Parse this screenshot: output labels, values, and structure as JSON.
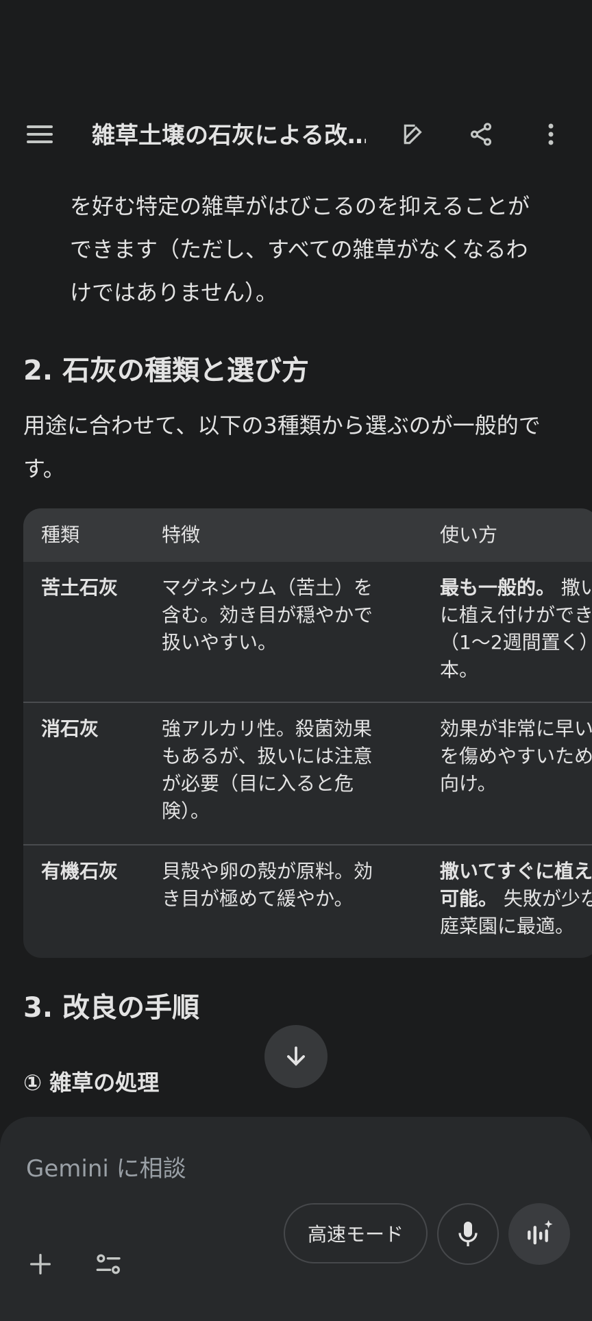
{
  "header": {
    "title": "雑草土壌の石灰による改…",
    "icons": [
      "menu-icon",
      "edit-icon",
      "share-icon",
      "more-vert-icon"
    ]
  },
  "intro_para": {
    "lines": [
      "を好む特定の雑草がはびこるのを抑えることが",
      "できます（ただし、すべての雑草がなくなるわ",
      "けではありません）。"
    ]
  },
  "section2": {
    "heading": "2. 石灰の種類と選び方",
    "para_lines": [
      "用途に合わせて、以下の3種類から選ぶのが一般的で",
      "す。"
    ]
  },
  "table": {
    "headers": [
      "種類",
      "特徴",
      "使い方"
    ],
    "rows": [
      {
        "type": "苦土石灰",
        "feature": [
          "マグネシウム（苦土）を",
          "含む。効き目が穏やかで",
          "扱いやすい。"
        ],
        "usage_bold": "最も一般的。",
        "usage": [
          " 撒い",
          "に植え付けができ",
          "（1〜2週間置く）",
          "本。"
        ]
      },
      {
        "type": "消石灰",
        "feature": [
          "強アルカリ性。殺菌効果",
          "もあるが、扱いには注意",
          "が必要（目に入ると危",
          "険）。"
        ],
        "usage_bold": "",
        "usage": [
          "効果が非常に早い",
          "を傷めやすいため",
          "向け。"
        ]
      },
      {
        "type": "有機石灰",
        "feature": [
          "貝殻や卵の殻が原料。効",
          "き目が極めて緩やか。"
        ],
        "usage_bold_lines": [
          "撒いてすぐに植え",
          "可能。"
        ],
        "usage": [
          " 失敗が少な",
          "庭菜園に最適。"
        ]
      }
    ]
  },
  "section3": {
    "heading": "3. 改良の手順",
    "subheading": "① 雑草の処理"
  },
  "composer": {
    "placeholder": "Gemini に相談",
    "mode_label": "高速モード"
  }
}
